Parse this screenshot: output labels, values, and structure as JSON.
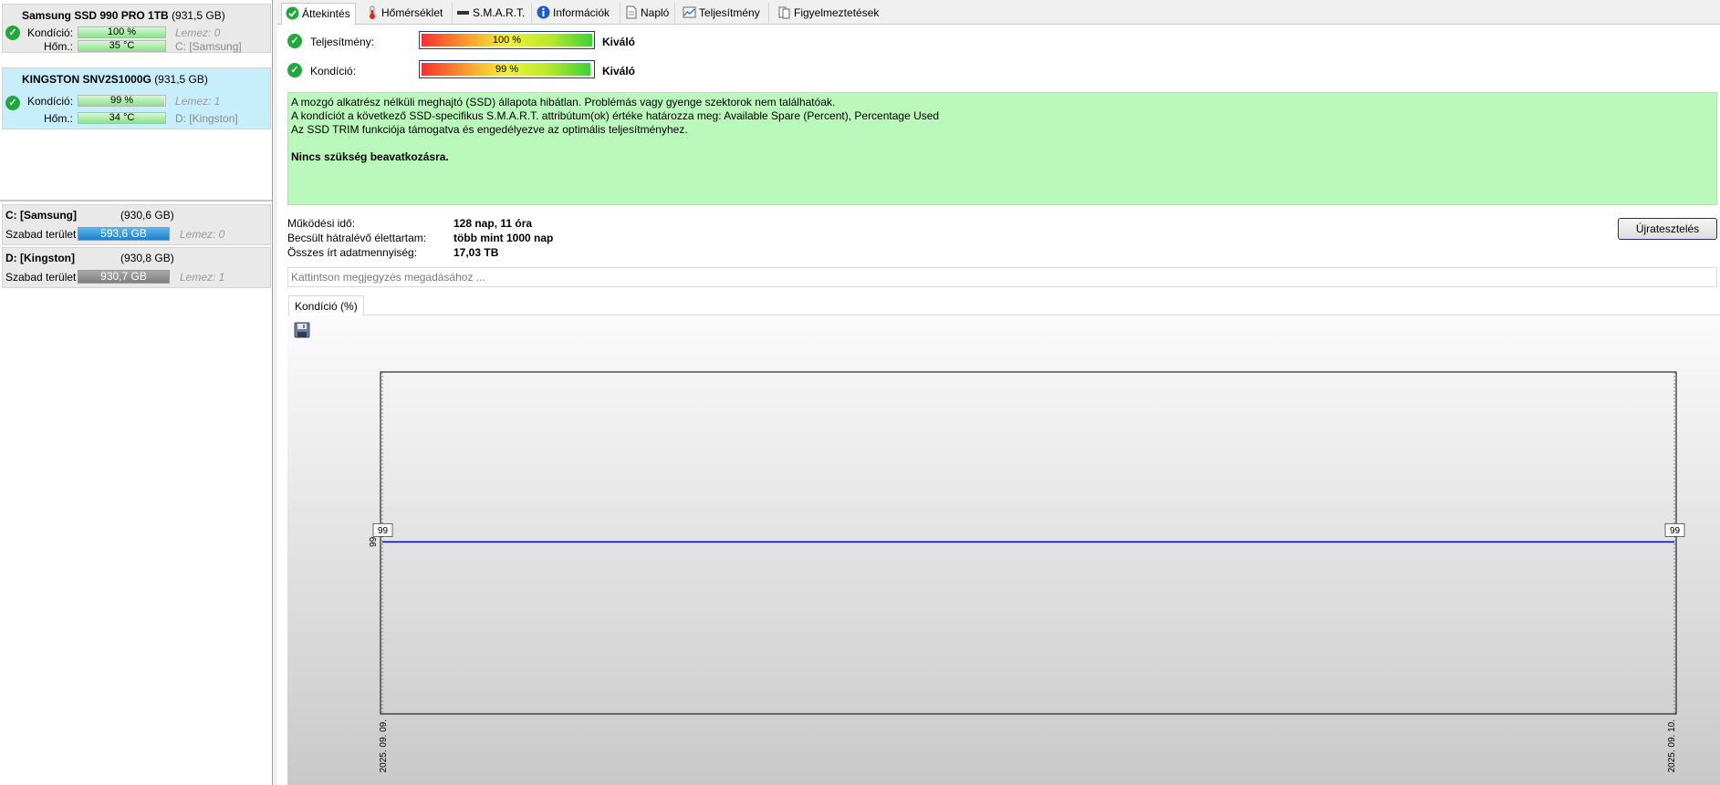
{
  "disks": [
    {
      "name": "Samsung SSD 990 PRO 1TB",
      "size": "(931,5 GB)",
      "condition_label": "Kondíció:",
      "condition_value": "100 %",
      "condition_percent": 100,
      "disk_label": "Lemez: 0",
      "temp_label": "Hőm.:",
      "temp_value": "35 °C",
      "temp_percent": 100,
      "drive_label": "C: [Samsung]",
      "selected": false
    },
    {
      "name": "KINGSTON SNV2S1000G",
      "size": "(931,5 GB)",
      "condition_label": "Kondíció:",
      "condition_value": "99 %",
      "condition_percent": 99,
      "disk_label": "Lemez: 1",
      "temp_label": "Hőm.:",
      "temp_value": "34 °C",
      "temp_percent": 100,
      "drive_label": "D: [Kingston]",
      "selected": true
    }
  ],
  "volumes": [
    {
      "name": "C: [Samsung]",
      "size": "(930,6 GB)",
      "free_label": "Szabad terület",
      "free_value": "593,6 GB",
      "disk_label": "Lemez: 0",
      "free_color": "#2a8fd9"
    },
    {
      "name": "D: [Kingston]",
      "size": "(930,8 GB)",
      "free_label": "Szabad terület",
      "free_value": "930,7 GB",
      "disk_label": "Lemez: 1",
      "free_color": "#8c8c8c"
    }
  ],
  "tabs": [
    {
      "label": "Áttekintés",
      "icon": "check-icon",
      "active": true
    },
    {
      "label": "Hőmérséklet",
      "icon": "thermometer-icon",
      "active": false
    },
    {
      "label": "S.M.A.R.T.",
      "icon": "smart-icon",
      "active": false
    },
    {
      "label": "Információk",
      "icon": "info-icon",
      "active": false
    },
    {
      "label": "Napló",
      "icon": "document-icon",
      "active": false
    },
    {
      "label": "Teljesítmény",
      "icon": "performance-chart-icon",
      "active": false
    },
    {
      "label": "Figyelmeztetések",
      "icon": "alerts-icon",
      "active": false
    }
  ],
  "status": {
    "performance_label": "Teljesítmény:",
    "performance_value": "100 %",
    "performance_rating": "Kiváló",
    "condition_label": "Kondíció:",
    "condition_value": "99 %",
    "condition_rating": "Kiváló"
  },
  "message": {
    "line1": "A mozgó alkatrész nélküli meghajtó (SSD) állapota hibátlan. Problémás vagy gyenge szektorok nem találhatóak.",
    "line2": "A kondíciót a következő SSD-specifikus S.M.A.R.T. attribútum(ok) értéke határozza meg:  Available Spare (Percent), Percentage Used",
    "line3": "Az SSD TRIM funkciója támogatva és engedélyezve az optimális teljesítményhez.",
    "bold_line": "Nincs szükség beavatkozásra."
  },
  "info": {
    "uptime_label": "Működési idő:",
    "uptime_value": "128 nap, 11 óra",
    "lifetime_label": "Becsült hátralévő élettartam:",
    "lifetime_value": "több mint 1000 nap",
    "written_label": "Összes írt adatmennyiség:",
    "written_value": "17,03 TB"
  },
  "retest_button": "Újratesztelés",
  "note_placeholder": "Kattintson megjegyzés megadásához ...",
  "chart_tab": "Kondíció  (%)",
  "chart_data": {
    "type": "line",
    "title": "",
    "x": [
      "2025. 09. 09.",
      "2025. 09. 10."
    ],
    "series": [
      {
        "values": [
          99,
          99
        ],
        "color": "#0000cc"
      }
    ],
    "y_tick_labels": [
      "99"
    ],
    "point_labels": [
      "99",
      "99"
    ],
    "grid": false
  }
}
